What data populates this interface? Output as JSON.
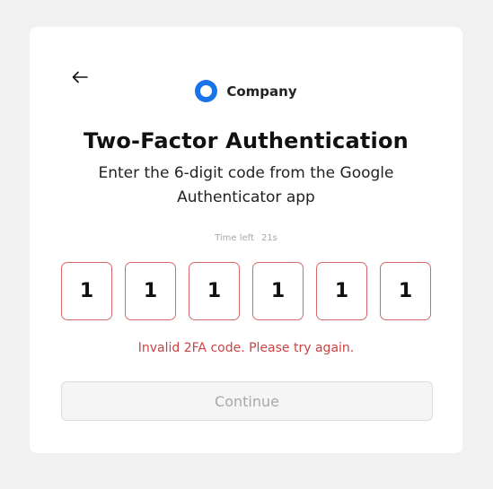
{
  "brand": {
    "name": "Company",
    "logo_color": "#1a73e8"
  },
  "page": {
    "title": "Two-Factor Authentication",
    "subtitle": "Enter the 6-digit code from the Google Authenticator app",
    "back_icon": "arrow-left-icon"
  },
  "timer": {
    "label": "Time left",
    "value": "21s"
  },
  "otp": {
    "digits": [
      "1",
      "1",
      "1",
      "1",
      "1",
      "1"
    ],
    "border_color": "#d66a6a"
  },
  "error": {
    "message": "Invalid 2FA code. Please try again.",
    "color": "#c94444"
  },
  "actions": {
    "continue_label": "Continue",
    "continue_disabled": true
  }
}
